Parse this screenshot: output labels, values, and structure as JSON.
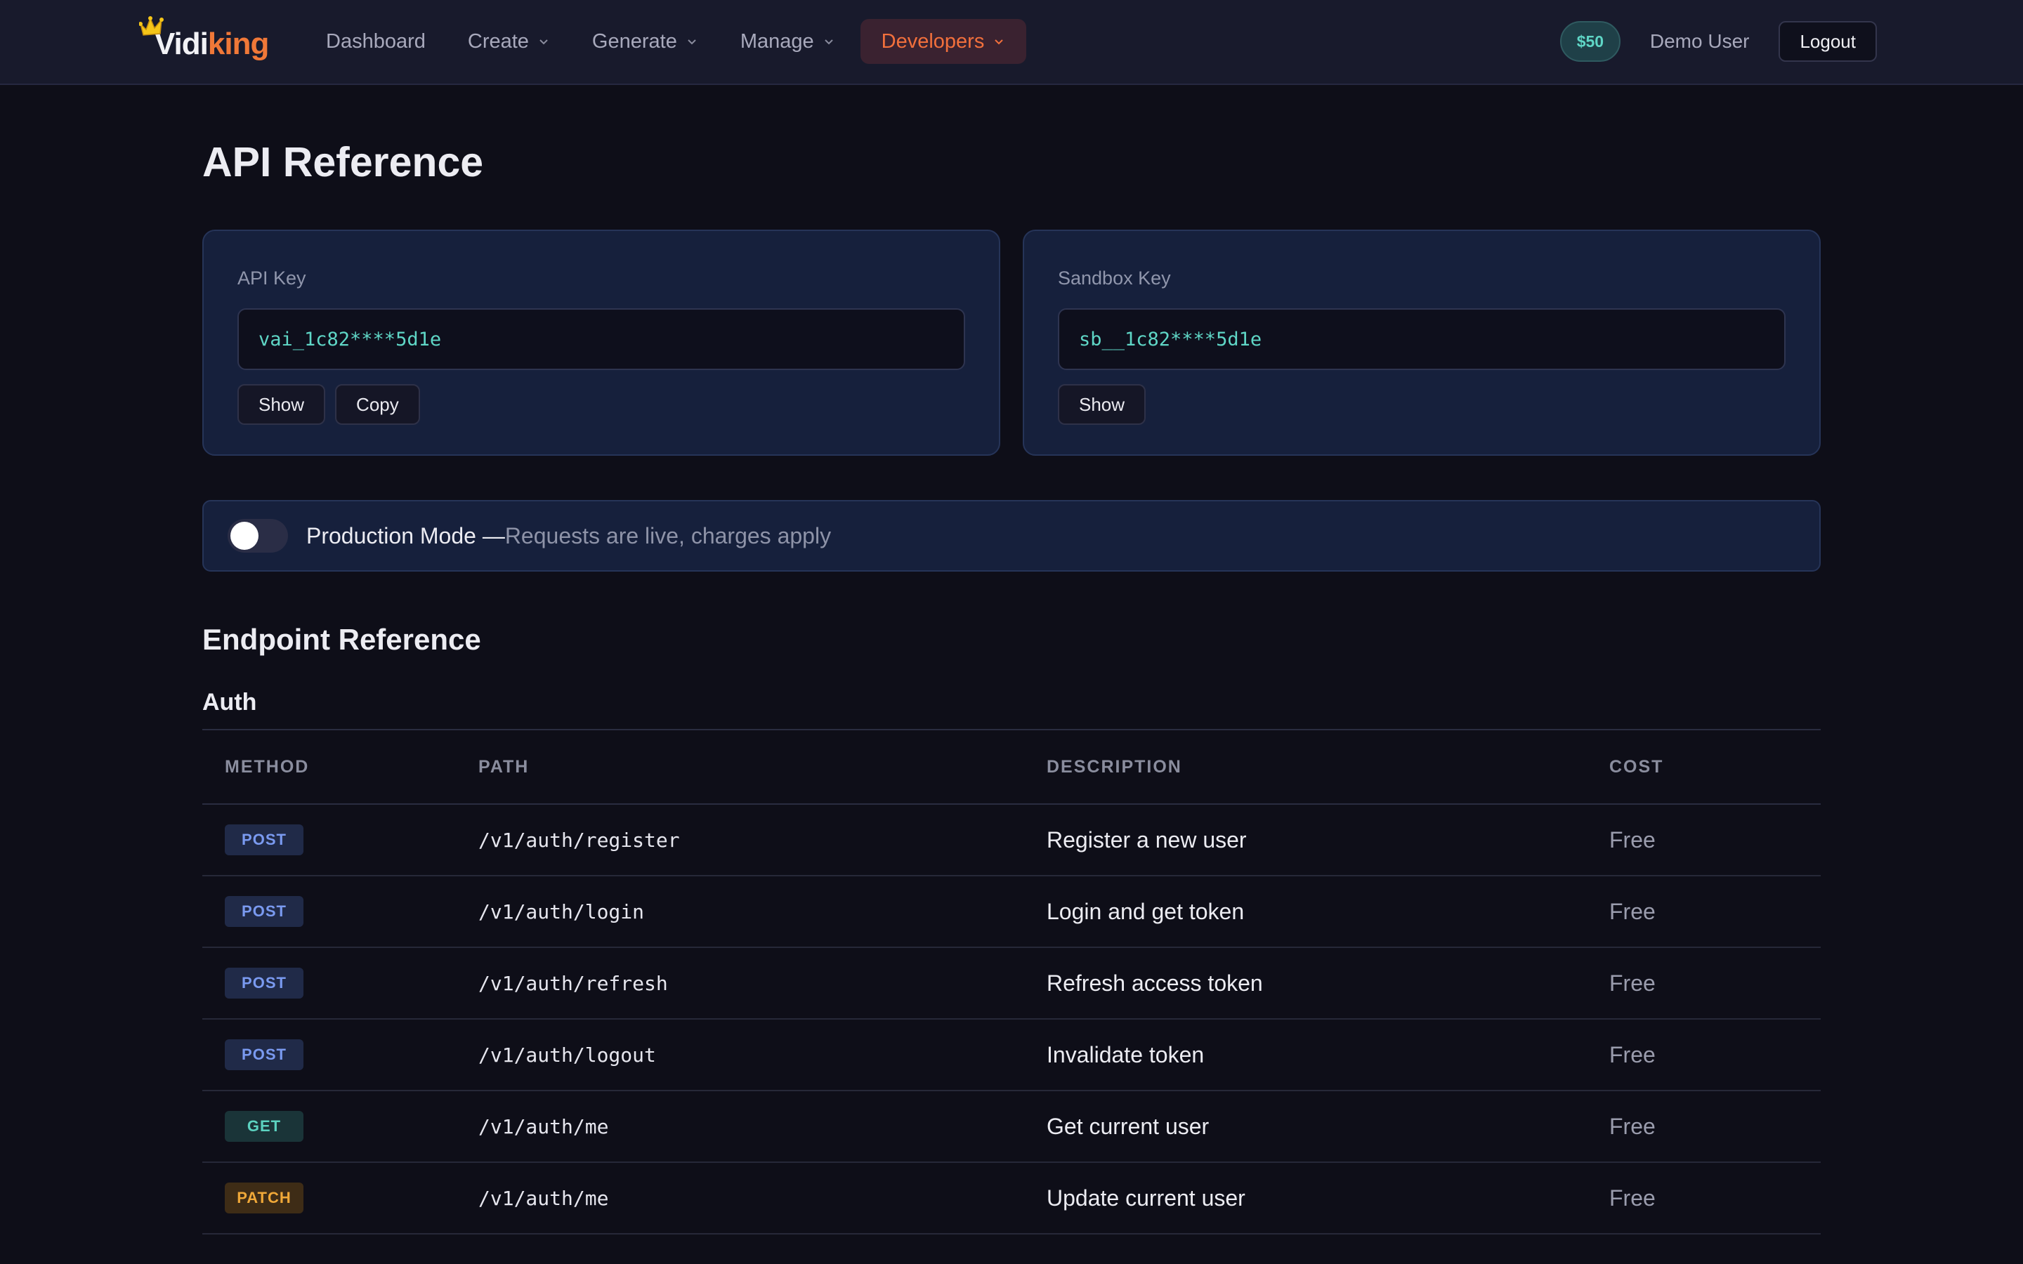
{
  "brand": {
    "part1": "Vidi",
    "part2": "king"
  },
  "nav": {
    "items": [
      {
        "label": "Dashboard",
        "dropdown": false
      },
      {
        "label": "Create",
        "dropdown": true
      },
      {
        "label": "Generate",
        "dropdown": true
      },
      {
        "label": "Manage",
        "dropdown": true
      },
      {
        "label": "Developers",
        "dropdown": true,
        "active": true
      }
    ],
    "credit": "$50",
    "user": "Demo User",
    "logout": "Logout"
  },
  "page": {
    "title": "API Reference"
  },
  "api_key": {
    "label": "API Key",
    "value": "vai_1c82****5d1e",
    "show": "Show",
    "copy": "Copy"
  },
  "sandbox_key": {
    "label": "Sandbox Key",
    "value": "sb__1c82****5d1e",
    "show": "Show"
  },
  "mode": {
    "label": "Production Mode — ",
    "description": "Requests are live, charges apply",
    "enabled": false
  },
  "endpoints": {
    "title": "Endpoint Reference",
    "group": "Auth",
    "columns": [
      "METHOD",
      "PATH",
      "DESCRIPTION",
      "COST"
    ],
    "rows": [
      {
        "method": "POST",
        "path": "/v1/auth/register",
        "description": "Register a new user",
        "cost": "Free"
      },
      {
        "method": "POST",
        "path": "/v1/auth/login",
        "description": "Login and get token",
        "cost": "Free"
      },
      {
        "method": "POST",
        "path": "/v1/auth/refresh",
        "description": "Refresh access token",
        "cost": "Free"
      },
      {
        "method": "POST",
        "path": "/v1/auth/logout",
        "description": "Invalidate token",
        "cost": "Free"
      },
      {
        "method": "GET",
        "path": "/v1/auth/me",
        "description": "Get current user",
        "cost": "Free"
      },
      {
        "method": "PATCH",
        "path": "/v1/auth/me",
        "description": "Update current user",
        "cost": "Free"
      }
    ]
  },
  "colors": {
    "accent": "#f07838",
    "key_text": "#5fd6c6",
    "post": "#7a9af0",
    "get": "#5cd2c0",
    "patch": "#f0a838"
  },
  "icons": {
    "logo": "crown-icon",
    "dropdown": "chevron-down-icon"
  }
}
